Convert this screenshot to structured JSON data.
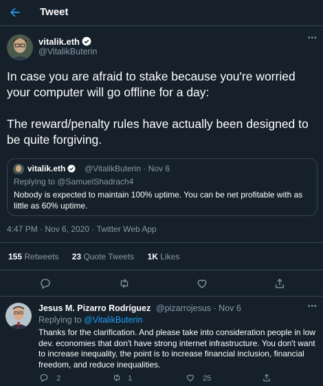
{
  "header": {
    "title": "Tweet"
  },
  "tweet": {
    "author_name": "vitalik.eth",
    "author_handle": "@VitalikButerin",
    "text": "In case you are afraid to stake because you're worried your computer will go offline for a day:\n\nThe reward/penalty rules have actually been designed to be quite forgiving.",
    "timestamp": "4:47 PM · Nov 6, 2020 · Twitter Web App",
    "stats": {
      "retweets_count": "155",
      "retweets_label": "Retweets",
      "quotes_count": "23",
      "quotes_label": "Quote Tweets",
      "likes_count": "1K",
      "likes_label": "Likes"
    }
  },
  "quote": {
    "author_name": "vitalik.eth",
    "handle_date": "@VitalikButerin · Nov 6",
    "replying_to": "Replying to @SamuelShadrach4",
    "text": "Nobody is expected to maintain 100% uptime. You can be net profitable with as little as 60% uptime."
  },
  "reply": {
    "author_name": "Jesus M. Pizarro Rodríguez",
    "handle_date": "@pizarrojesus · Nov 6",
    "replying_prefix": "Replying to ",
    "replying_mention": "@VitalikButerin",
    "text": "Thanks for the clarification. And please take into consideration people in low dev. economies that don't have strong internet infrastructure. You don't want to increase inequality, the point is to increase financial inclusion, financial freedom, and reduce inequalities.",
    "reply_count": "2",
    "retweet_count": "1",
    "like_count": "25"
  },
  "colors": {
    "background": "#15202b",
    "accent": "#1da1f2",
    "muted": "#8899a6",
    "border": "#38444d"
  }
}
